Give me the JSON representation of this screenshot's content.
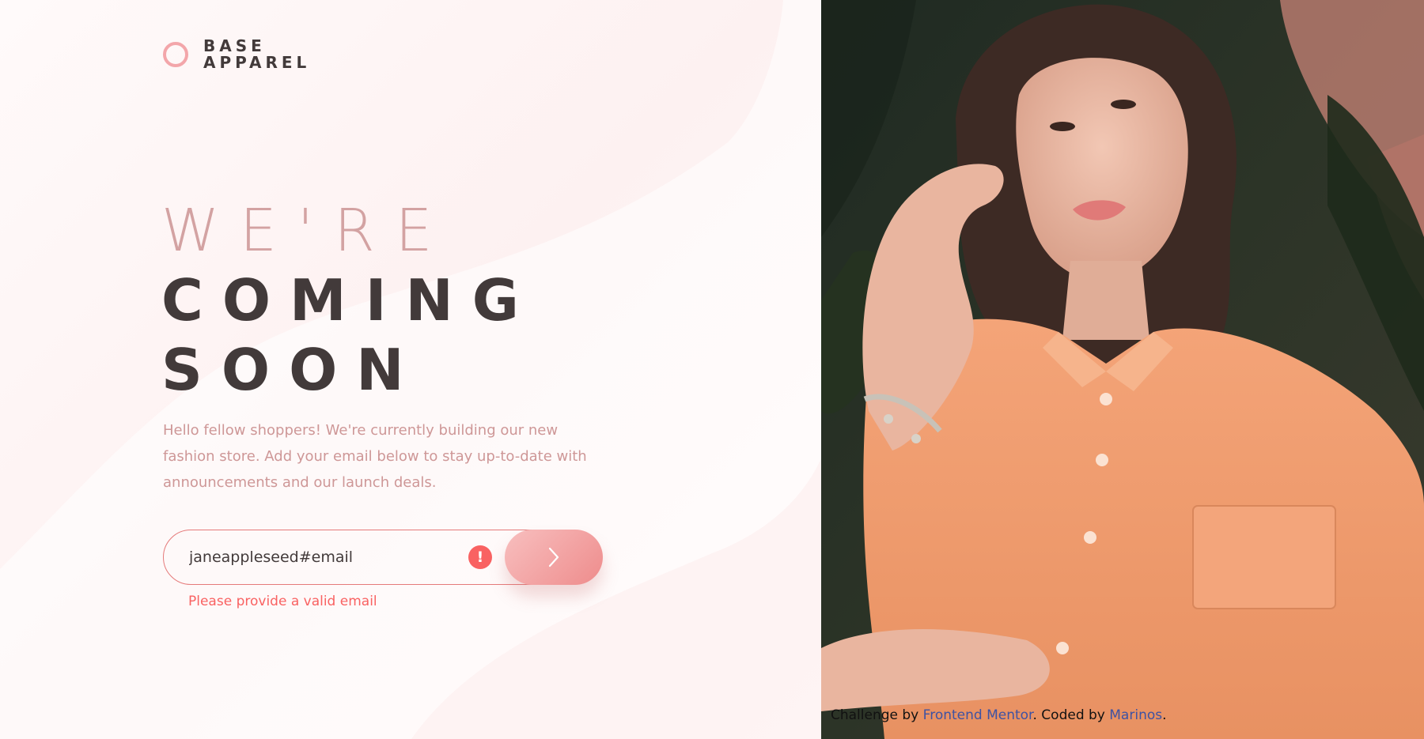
{
  "brand": {
    "line1": "BASE",
    "line2": "APPAREL"
  },
  "headline": {
    "line1": "WE'RE",
    "line2": "COMING",
    "line3": "SOON"
  },
  "description": "Hello fellow shoppers! We're currently building our new fashion store. Add your email below to stay up-to-date with announcements and our launch deals.",
  "form": {
    "email_value": "janeappleseed#email",
    "error_icon": "!",
    "error_message": "Please provide a valid email",
    "submit_icon": "chevron-right-icon"
  },
  "attribution": {
    "prefix": "Challenge by ",
    "link1": "Frontend Mentor",
    "middle": ". Coded by ",
    "link2": "Marinos",
    "suffix": "."
  },
  "colors": {
    "accent_pink": "#f3a6aa",
    "error": "#f96262",
    "text_dark": "#423a3a",
    "text_muted": "#ce9797",
    "link": "#3e52a3"
  }
}
